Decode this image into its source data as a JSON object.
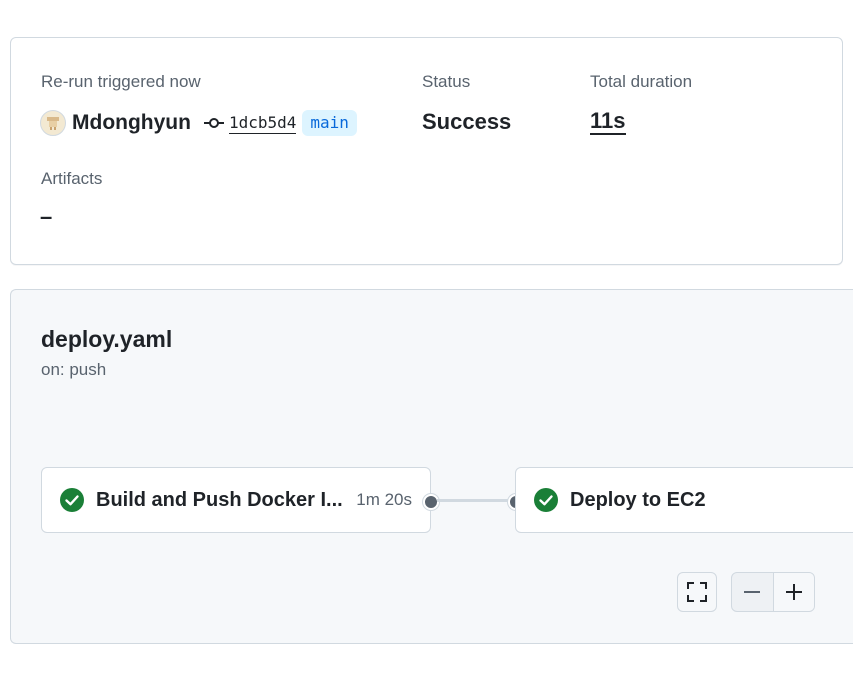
{
  "summary": {
    "trigger_label": "Re-run triggered now",
    "actor": "Mdonghyun",
    "commit_sha": "1dcb5d4",
    "branch": "main",
    "status_label": "Status",
    "status_value": "Success",
    "duration_label": "Total duration",
    "duration_value": "11s",
    "artifacts_label": "Artifacts",
    "artifacts_value": "–"
  },
  "workflow": {
    "file_name": "deploy.yaml",
    "trigger": "on: push",
    "jobs": [
      {
        "name": "Build and Push Docker I...",
        "duration": "1m 20s",
        "status": "success"
      },
      {
        "name": "Deploy to EC2",
        "duration": "",
        "status": "success"
      }
    ]
  },
  "icons": {
    "commit": "git-commit-icon",
    "job_status": "check-circle-fill-icon",
    "fullscreen": "screen-full-icon",
    "zoom_out": "dash-icon",
    "zoom_in": "plus-icon"
  },
  "colors": {
    "success": "#1a7f37",
    "branch_bg": "#ddf4ff",
    "branch_fg": "#0969da",
    "muted": "#59636e",
    "border": "#d1d9e0"
  }
}
